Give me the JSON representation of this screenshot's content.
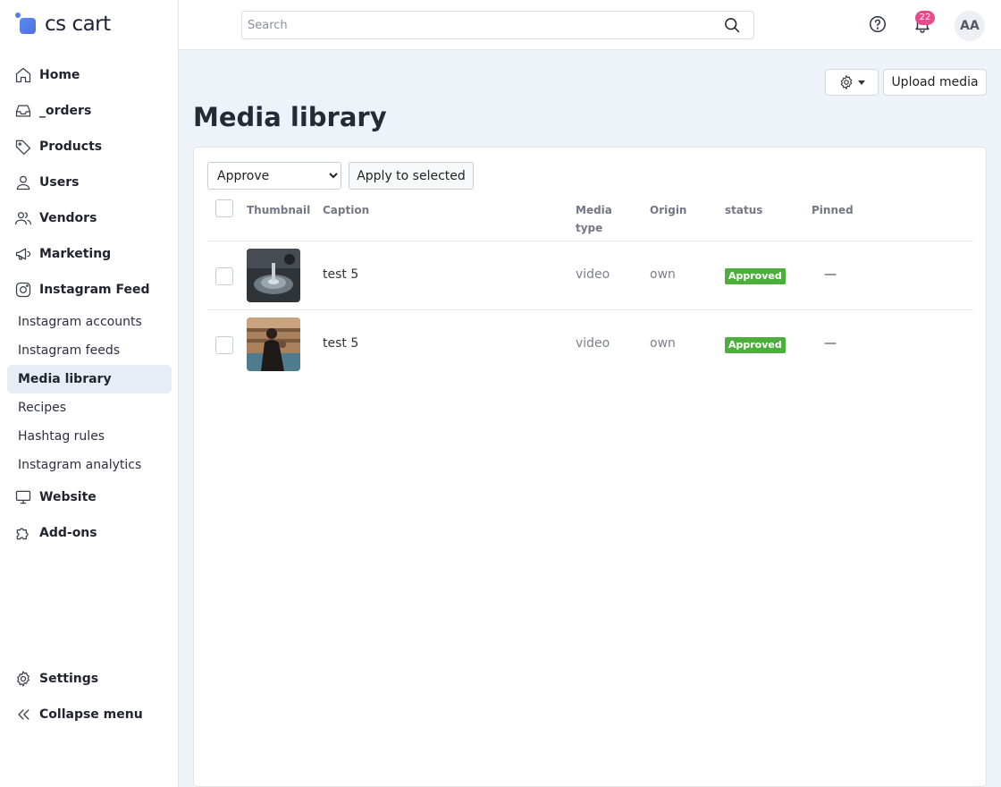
{
  "brand": {
    "name": "cs cart"
  },
  "sidebar": {
    "items": [
      {
        "label": "Home",
        "icon": "home-icon"
      },
      {
        "label": "_orders",
        "icon": "inbox-icon"
      },
      {
        "label": "Products",
        "icon": "tag-icon"
      },
      {
        "label": "Users",
        "icon": "user-icon"
      },
      {
        "label": "Vendors",
        "icon": "users-icon"
      },
      {
        "label": "Marketing",
        "icon": "megaphone-icon"
      },
      {
        "label": "Instagram Feed",
        "icon": "instagram-icon"
      }
    ],
    "subitems": [
      {
        "label": "Instagram accounts"
      },
      {
        "label": "Instagram feeds"
      },
      {
        "label": "Media library",
        "active": true
      },
      {
        "label": "Recipes"
      },
      {
        "label": "Hashtag rules"
      },
      {
        "label": "Instagram analytics"
      }
    ],
    "items_after": [
      {
        "label": "Website",
        "icon": "monitor-icon"
      },
      {
        "label": "Add-ons",
        "icon": "puzzle-icon"
      }
    ],
    "bottom": [
      {
        "label": "Settings",
        "icon": "gear-icon"
      },
      {
        "label": "Collapse menu",
        "icon": "double-chevron-left-icon"
      }
    ]
  },
  "topbar": {
    "search_placeholder": "Search",
    "notifications_count": "22",
    "avatar_initials": "AA"
  },
  "header": {
    "title": "Media library",
    "upload_label": "Upload media"
  },
  "toolbar": {
    "action_selected": "Approve",
    "apply_label": "Apply to selected"
  },
  "table": {
    "columns": [
      "Thumbnail",
      "Caption",
      "Media type",
      "Origin",
      "status",
      "Pinned"
    ],
    "rows": [
      {
        "caption": "test 5",
        "media_type": "video",
        "origin": "own",
        "status": "Approved",
        "pinned": "—"
      },
      {
        "caption": "test 5",
        "media_type": "video",
        "origin": "own",
        "status": "Approved",
        "pinned": "—"
      }
    ]
  },
  "colors": {
    "accent": "#4f7cf0",
    "approved": "#4caf3b",
    "badge": "#e84a8a"
  }
}
